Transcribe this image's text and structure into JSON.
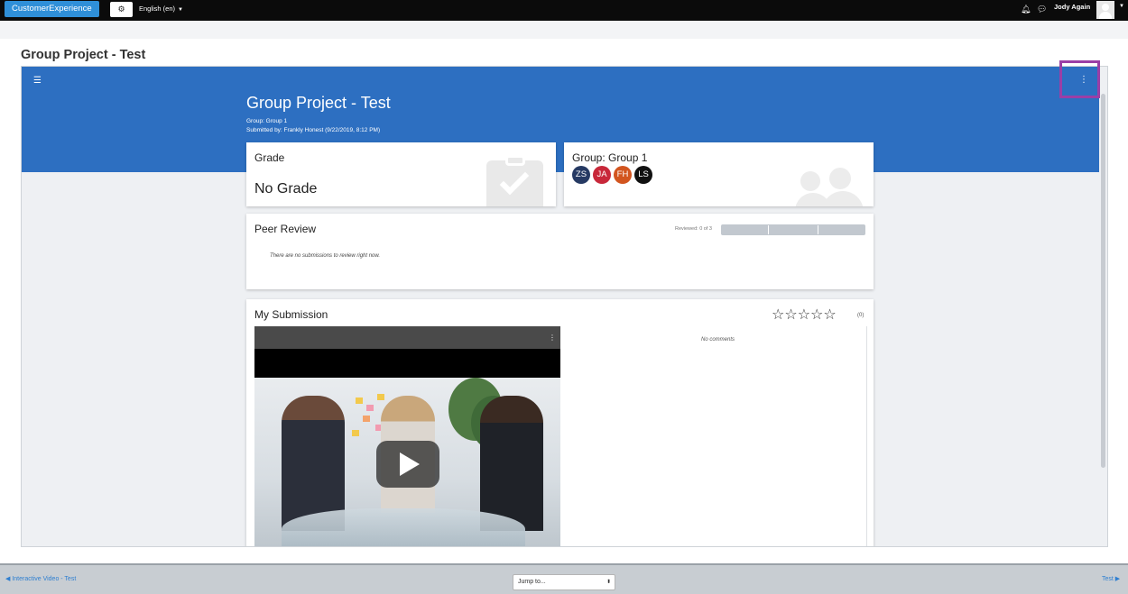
{
  "topnav": {
    "brand_label": "CustomerExperience",
    "settings_icon": "gear-icon",
    "language": "English (en)",
    "user_name": "Jody Again"
  },
  "page": {
    "title": "Group Project - Test"
  },
  "activity": {
    "title": "Group Project - Test",
    "group_line": "Group: Group 1",
    "submitted_line": "Submitted by: Frankly Honest (9/22/2019, 8:12 PM)",
    "banner_color": "#2d6fc1"
  },
  "grade_card": {
    "title": "Grade",
    "value": "No Grade"
  },
  "group_card": {
    "title": "Group: Group 1",
    "members": [
      {
        "initials": "ZS",
        "color": "#263a63"
      },
      {
        "initials": "JA",
        "color": "#c8283a"
      },
      {
        "initials": "FH",
        "color": "#d2551f"
      },
      {
        "initials": "LS",
        "color": "#111111"
      }
    ]
  },
  "peer_review": {
    "title": "Peer Review",
    "reviewed_text": "Reviewed: 0 of 3",
    "progress_fraction": 0,
    "empty_message": "There are no submissions to review right now."
  },
  "submission": {
    "title": "My Submission",
    "rating_stars": "☆☆☆☆☆",
    "rating_count": "(0)",
    "comments_empty": "No comments"
  },
  "footer": {
    "prev_link": "◀ Interactive Video - Test",
    "next_link": "Test ▶",
    "jump_placeholder": "Jump to..."
  }
}
